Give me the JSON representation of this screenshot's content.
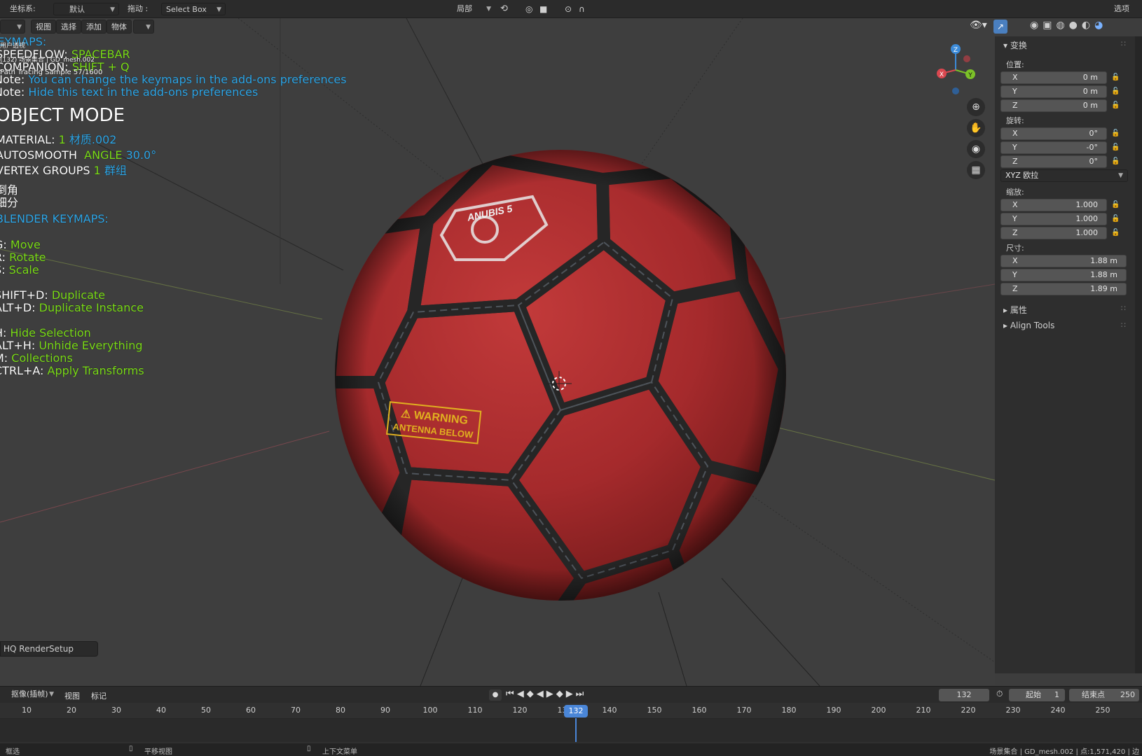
{
  "topbar": {
    "coord_label": "坐标系:",
    "coord_value": "默认",
    "drag_label": "拖动 :",
    "drag_value": "Select Box",
    "pivot_value": "局部",
    "options_label": "选项"
  },
  "viewport_header": {
    "menus": [
      "视图",
      "选择",
      "添加",
      "物体"
    ]
  },
  "overlay": {
    "keymaps_title": "KEYMAPS:",
    "speedflow_label": "SPEEDFLOW:",
    "speedflow_key": "SPACEBAR",
    "companion_label": "COMPANION:",
    "companion_key": "SHIFT + Q",
    "note_label": "Note:",
    "note1_text": "You can change the keymaps in the add-ons preferences",
    "note2_text": "Hide this text in the add-ons preferences",
    "user_persp": "用户透视",
    "collection_line": "(132) 场景集合 | GD_mesh.002",
    "path_tracing": "Path Tracing Sample 57/1600",
    "mode": "OBJECT MODE",
    "material_label": "MATERIAL:",
    "material_count": "1",
    "material_name": "材质.002",
    "autosmooth_label": "AUTOSMOOTH",
    "angle_label": "ANGLE",
    "angle_value": "30.0°",
    "vgroups_label": "VERTEX GROUPS",
    "vgroups_count": "1",
    "vgroups_name": "群组",
    "bevel": "倒角",
    "subdiv": "细分",
    "blender_keymaps": "BLENDER KEYMAPS:",
    "keys": [
      {
        "key": "G:",
        "action": "Move"
      },
      {
        "key": "R:",
        "action": "Rotate"
      },
      {
        "key": "S:",
        "action": "Scale"
      },
      {
        "key": "SHIFT+D:",
        "action": "Duplicate"
      },
      {
        "key": "ALT+D:",
        "action": "Duplicate Instance"
      },
      {
        "key": "H:",
        "action": "Hide Selection"
      },
      {
        "key": "ALT+H:",
        "action": "Unhide Everything"
      },
      {
        "key": "M:",
        "action": "Collections"
      },
      {
        "key": "CTRL+A:",
        "action": "Apply Transforms"
      }
    ],
    "hq_render": "HQ RenderSetup"
  },
  "ball": {
    "logo_text": "ANUBIS 5",
    "warning_line1": "⚠ WARNING",
    "warning_line2": "ANTENNA BELOW",
    "panel_color": "#a82a2c",
    "seam_color": "#262626"
  },
  "npanel": {
    "transform_title": "变换",
    "location_label": "位置:",
    "location": [
      {
        "axis": "X",
        "value": "0 m"
      },
      {
        "axis": "Y",
        "value": "0 m"
      },
      {
        "axis": "Z",
        "value": "0 m"
      }
    ],
    "rotation_label": "旋转:",
    "rotation": [
      {
        "axis": "X",
        "value": "0°"
      },
      {
        "axis": "Y",
        "value": "-0°"
      },
      {
        "axis": "Z",
        "value": "0°"
      }
    ],
    "rotation_mode": "XYZ 欧拉",
    "scale_label": "缩放:",
    "scale": [
      {
        "axis": "X",
        "value": "1.000"
      },
      {
        "axis": "Y",
        "value": "1.000"
      },
      {
        "axis": "Z",
        "value": "1.000"
      }
    ],
    "dimensions_label": "尺寸:",
    "dimensions": [
      {
        "axis": "X",
        "value": "1.88 m"
      },
      {
        "axis": "Y",
        "value": "1.88 m"
      },
      {
        "axis": "Z",
        "value": "1.89 m"
      }
    ],
    "properties": "属性",
    "align_tools": "Align Tools"
  },
  "gizmo": {
    "x": "X",
    "y": "Y",
    "z": "Z"
  },
  "timeline": {
    "playback_label": "抠像(插帧)",
    "view_label": "视图",
    "marker_label": "标记",
    "current_frame": "132",
    "start_label": "起始",
    "start_value": "1",
    "end_label": "结束点",
    "end_value": "250",
    "ticks": [
      "10",
      "20",
      "30",
      "40",
      "50",
      "60",
      "70",
      "80",
      "90",
      "100",
      "110",
      "120",
      "130",
      "140",
      "150",
      "160",
      "170",
      "180",
      "190",
      "200",
      "210",
      "220",
      "230",
      "240",
      "250"
    ],
    "playhead": "132"
  },
  "statusbar": {
    "select": "框选",
    "pan": "平移视图",
    "context": "上下文菜单",
    "info": "场景集合 | GD_mesh.002 | 点:1,571,420 | 边"
  }
}
